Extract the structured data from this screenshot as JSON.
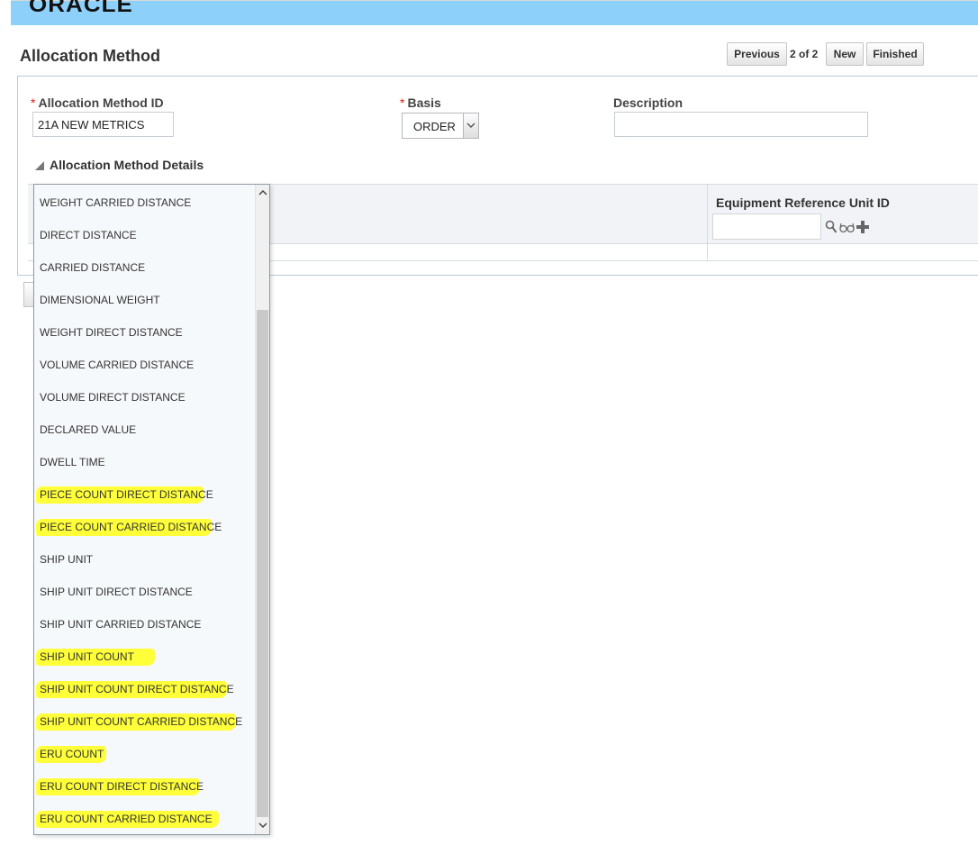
{
  "header": {
    "logo_text": "ORACLE"
  },
  "page": {
    "title": "Allocation Method"
  },
  "nav": {
    "previous_label": "Previous",
    "counter": "2 of 2",
    "new_label": "New",
    "finished_label": "Finished"
  },
  "form": {
    "required_marker": "*",
    "id_label": "Allocation Method ID",
    "id_value": "21A NEW METRICS",
    "basis_label": "Basis",
    "basis_value": "ORDER",
    "description_label": "Description",
    "description_value": ""
  },
  "details": {
    "section_title": "Allocation Method Details",
    "column_header": "Equipment Reference Unit ID"
  },
  "dropdown": {
    "options": [
      {
        "label": "WEIGHT CARRIED DISTANCE",
        "highlighted": false
      },
      {
        "label": "DIRECT DISTANCE",
        "highlighted": false
      },
      {
        "label": "CARRIED DISTANCE",
        "highlighted": false
      },
      {
        "label": "DIMENSIONAL WEIGHT",
        "highlighted": false
      },
      {
        "label": "WEIGHT DIRECT DISTANCE",
        "highlighted": false
      },
      {
        "label": "VOLUME CARRIED DISTANCE",
        "highlighted": false
      },
      {
        "label": "VOLUME DIRECT DISTANCE",
        "highlighted": false
      },
      {
        "label": "DECLARED VALUE",
        "highlighted": false
      },
      {
        "label": "DWELL TIME",
        "highlighted": false
      },
      {
        "label": "PIECE COUNT DIRECT DISTANCE",
        "highlighted": true
      },
      {
        "label": "PIECE COUNT CARRIED DISTANCE",
        "highlighted": true
      },
      {
        "label": "SHIP UNIT",
        "highlighted": false
      },
      {
        "label": "SHIP UNIT DIRECT DISTANCE",
        "highlighted": false
      },
      {
        "label": "SHIP UNIT CARRIED DISTANCE",
        "highlighted": false
      },
      {
        "label": "SHIP UNIT COUNT",
        "highlighted": true
      },
      {
        "label": "SHIP UNIT COUNT DIRECT DISTANCE",
        "highlighted": true
      },
      {
        "label": "SHIP UNIT COUNT CARRIED DISTANCE",
        "highlighted": true
      },
      {
        "label": "ERU COUNT",
        "highlighted": true
      },
      {
        "label": "ERU COUNT DIRECT DISTANCE",
        "highlighted": true
      },
      {
        "label": "ERU COUNT CARRIED DISTANCE",
        "highlighted": true
      }
    ],
    "highlight_color": "#ffff3a"
  },
  "colors": {
    "top_bar": "#8dd1fb",
    "required": "#dd1111"
  },
  "icons": [
    "search-icon",
    "glasses-icon",
    "plus-icon",
    "chevron-down-icon",
    "collapse-triangle-icon",
    "scroll-up-icon",
    "scroll-down-icon"
  ]
}
